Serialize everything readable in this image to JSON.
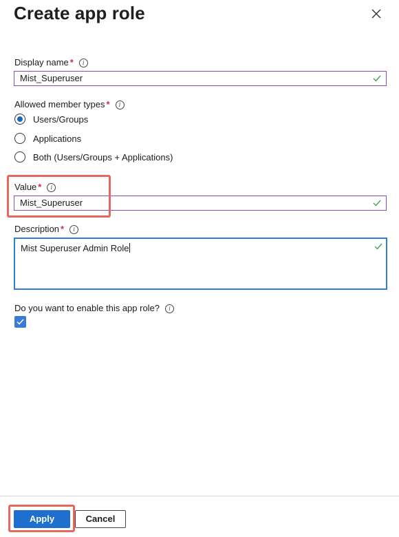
{
  "dialog": {
    "title": "Create app role",
    "close_icon": "close-icon"
  },
  "display_name": {
    "label": "Display name",
    "required_mark": "*",
    "value": "Mist_Superuser"
  },
  "member_types": {
    "label": "Allowed member types",
    "required_mark": "*",
    "options": [
      {
        "label": "Users/Groups",
        "selected": true
      },
      {
        "label": "Applications",
        "selected": false
      },
      {
        "label": "Both (Users/Groups + Applications)",
        "selected": false
      }
    ]
  },
  "value_field": {
    "label": "Value",
    "required_mark": "*",
    "value": "Mist_Superuser"
  },
  "description": {
    "label": "Description",
    "required_mark": "*",
    "value": "Mist Superuser Admin Role"
  },
  "enable": {
    "label": "Do you want to enable this app role?",
    "checked": true
  },
  "footer": {
    "apply_label": "Apply",
    "cancel_label": "Cancel"
  },
  "colors": {
    "accent": "#0f6cbd",
    "field_border": "#8c4bb8",
    "valid_check": "#3da35a",
    "highlight": "#e5675f"
  }
}
